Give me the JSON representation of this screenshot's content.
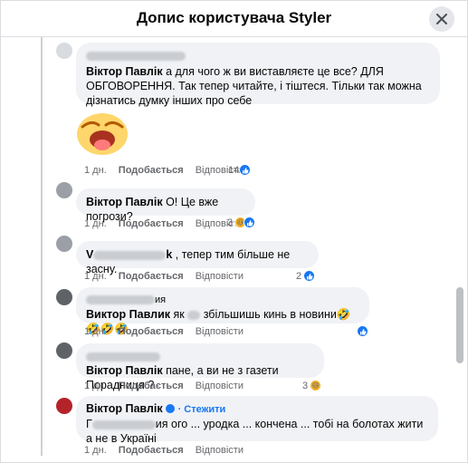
{
  "header": {
    "title": "Допис користувача Styler"
  },
  "comments": [
    {
      "author": "Віктор Павлік",
      "text": "а для чого ж ви виставляєте це все? ДЛЯ ОБГОВОРЕННЯ. Так тепер читайте, і тіштеся. Тільки так можна дізнатись думку інших про себе",
      "time": "1 дн.",
      "like": "Подобається",
      "reply": "Відповісти",
      "reactions": "14"
    },
    {
      "author": "Віктор Павлік",
      "text": "О! Це вже погрози?",
      "time": "1 дн.",
      "like": "Подобається",
      "reply": "Відповісти",
      "reactions": "3"
    },
    {
      "author_prefix": "V",
      "author_suffix": "k",
      "text": ", тепер тим більше не засну.",
      "time": "1 дн.",
      "like": "Подобається",
      "reply": "Відповісти",
      "reactions": "2"
    },
    {
      "name_tail": "ия",
      "author": "Виктор Павлик",
      "text_a": "як",
      "text_b": "збільшишь кинь в новини",
      "emojis": "🤣🤣🤣🤣",
      "time": "1 дн.",
      "like": "Подобається",
      "reply": "Відповісти"
    },
    {
      "author": "Віктор Павлік",
      "text": "пане, а ви не з газети Порадниця ?",
      "time": "1 дн.",
      "like": "Подобається",
      "reply": "Відповісти",
      "reactions": "3"
    },
    {
      "author": "Віктор Павлік",
      "follow": "· Стежити",
      "text_prefix": "Г",
      "text": "ия ого ... уродка ... кончена ... тобі на болотах жити а не в Україні",
      "time": "1 дн.",
      "like": "Подобається",
      "reply": "Відповісти"
    }
  ],
  "colors": {
    "accent": "#1877f2",
    "bubble": "#f0f2f5",
    "meta": "#65676b"
  }
}
